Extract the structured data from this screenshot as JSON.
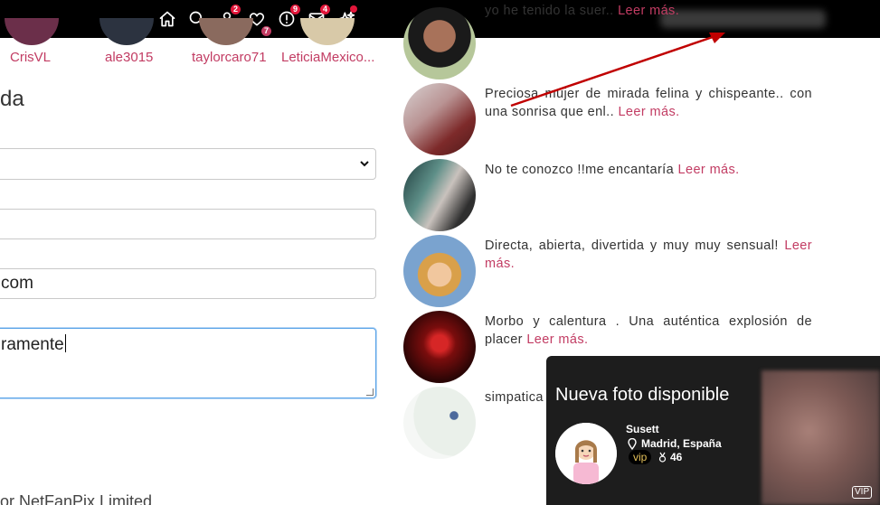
{
  "topbar": {
    "icons": [
      {
        "name": "home-icon",
        "badge": ""
      },
      {
        "name": "search-icon",
        "badge": ""
      },
      {
        "name": "user-icon",
        "badge": "2"
      },
      {
        "name": "heart-icon",
        "badge": "7"
      },
      {
        "name": "alert-icon",
        "badge": "9"
      },
      {
        "name": "mail-icon",
        "badge": "4"
      },
      {
        "name": "sparkle-icon",
        "badge": ""
      }
    ]
  },
  "avatar_strip": [
    "CrisVL",
    "ale3015",
    "taylorcaro71",
    "LeticiaMexico..."
  ],
  "form": {
    "section_title": "da",
    "email_value": "com",
    "textarea_value": "ramente"
  },
  "footer": {
    "text": "or NetFanPix Limited"
  },
  "profiles": [
    {
      "text": "yo he tenido la suer..",
      "more": "Leer más."
    },
    {
      "text": "Preciosa mujer de mirada felina y chispeante.. con una sonrisa que enl..",
      "more": "Leer más."
    },
    {
      "text": "No te conozco !!me encantaría",
      "more": "Leer más."
    },
    {
      "text": "Directa, abierta, divertida y muy muy sensual!",
      "more": "Leer más."
    },
    {
      "text": "Morbo y calentura . Una auténtica explosión de placer",
      "more": "Leer más."
    },
    {
      "text": "simpatica",
      "more": ""
    }
  ],
  "notification": {
    "title": "Nueva foto disponible",
    "name": "Susett",
    "location": "Madrid, España",
    "vip": "vip",
    "count": "46",
    "photo_tag": "VIP"
  },
  "colors": {
    "accent": "#c23c63",
    "badge": "#e3163a",
    "arrow": "#c00000"
  }
}
